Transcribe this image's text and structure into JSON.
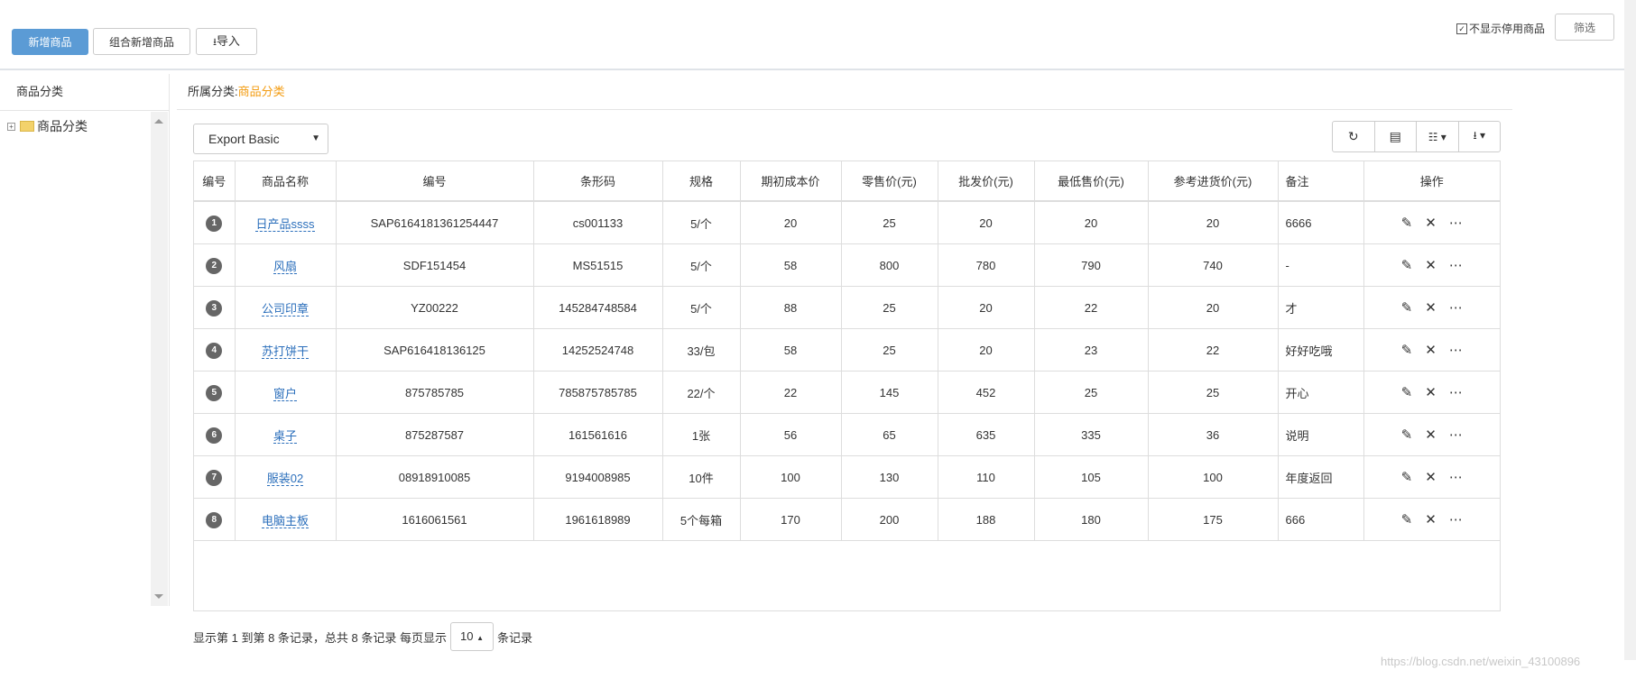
{
  "toolbar": {
    "add_label": "新增商品",
    "combo_add_label": "组合新增商品",
    "import_label": "导入",
    "hide_disabled_label": "不显示停用商品",
    "filter_label": "筛选"
  },
  "sidebar": {
    "title": "商品分类",
    "tree_root": "商品分类"
  },
  "breadcrumb": {
    "label": "所属分类:",
    "value": "商品分类"
  },
  "export": {
    "selected": "Export Basic"
  },
  "table": {
    "columns": [
      "编号",
      "商品名称",
      "编号",
      "条形码",
      "规格",
      "期初成本价",
      "零售价(元)",
      "批发价(元)",
      "最低售价(元)",
      "参考进货价(元)",
      "备注",
      "操作"
    ],
    "rows": [
      {
        "idx": "1",
        "name": "日产品ssss",
        "code": "SAP6164181361254447",
        "barcode": "cs001133",
        "spec": "5/个",
        "cost": "20",
        "retail": "25",
        "wholesale": "20",
        "min": "20",
        "ref": "20",
        "note": "6666"
      },
      {
        "idx": "2",
        "name": "风扇",
        "code": "SDF151454",
        "barcode": "MS51515",
        "spec": "5/个",
        "cost": "58",
        "retail": "800",
        "wholesale": "780",
        "min": "790",
        "ref": "740",
        "note": "-"
      },
      {
        "idx": "3",
        "name": "公司印章",
        "code": "YZ00222",
        "barcode": "145284748584",
        "spec": "5/个",
        "cost": "88",
        "retail": "25",
        "wholesale": "20",
        "min": "22",
        "ref": "20",
        "note": "才"
      },
      {
        "idx": "4",
        "name": "苏打饼干",
        "code": "SAP616418136125",
        "barcode": "14252524748",
        "spec": "33/包",
        "cost": "58",
        "retail": "25",
        "wholesale": "20",
        "min": "23",
        "ref": "22",
        "note": "好好吃哦"
      },
      {
        "idx": "5",
        "name": "窗户",
        "code": "875785785",
        "barcode": "785875785785",
        "spec": "22/个",
        "cost": "22",
        "retail": "145",
        "wholesale": "452",
        "min": "25",
        "ref": "25",
        "note": "开心"
      },
      {
        "idx": "6",
        "name": "桌子",
        "code": "875287587",
        "barcode": "161561616",
        "spec": "1张",
        "cost": "56",
        "retail": "65",
        "wholesale": "635",
        "min": "335",
        "ref": "36",
        "note": "说明"
      },
      {
        "idx": "7",
        "name": "服装02",
        "code": "08918910085",
        "barcode": "9194008985",
        "spec": "10件",
        "cost": "100",
        "retail": "130",
        "wholesale": "110",
        "min": "105",
        "ref": "100",
        "note": "年度返回"
      },
      {
        "idx": "8",
        "name": "电脑主板",
        "code": "1616061561",
        "barcode": "1961618989",
        "spec": "5个每箱",
        "cost": "170",
        "retail": "200",
        "wholesale": "188",
        "min": "180",
        "ref": "175",
        "note": "666"
      }
    ]
  },
  "pagination": {
    "summary": "显示第 1 到第 8 条记录，总共 8 条记录 每页显示",
    "page_size": "10",
    "suffix": "条记录"
  },
  "watermark": "https://blog.csdn.net/weixin_43100896",
  "colors": {
    "primary": "#5b9bd5",
    "link": "#2a6ebb",
    "accent": "#f39c12"
  }
}
